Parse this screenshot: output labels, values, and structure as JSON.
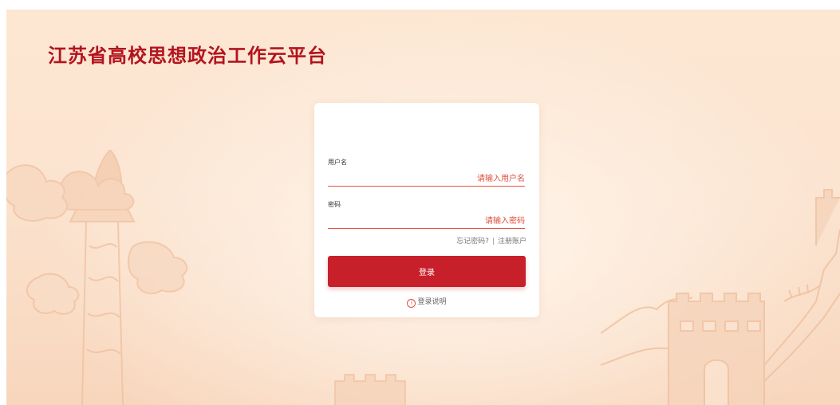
{
  "header": {
    "title": "江苏省高校思想政治工作云平台"
  },
  "login": {
    "username_label": "用户名",
    "username_placeholder": "请输入用户名",
    "password_label": "密码",
    "password_placeholder": "请输入密码",
    "forgot_password": "忘记密码?",
    "separator": "|",
    "register": "注册账户",
    "submit_label": "登录",
    "help_label": "登录说明"
  },
  "colors": {
    "brand_red": "#c8202a",
    "title_red": "#b3141e",
    "input_accent": "#e0503e",
    "background": "#fbe3cf"
  },
  "icons": {
    "help": "info-circle-icon",
    "decor_left": "huabiao-column-illustration",
    "decor_right": "great-wall-illustration"
  }
}
